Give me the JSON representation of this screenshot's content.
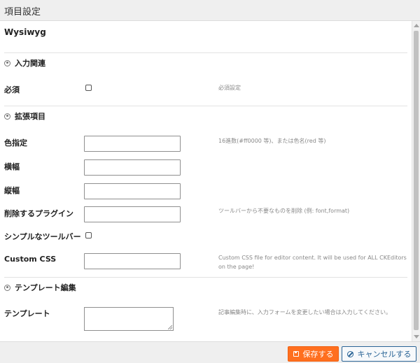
{
  "header": {
    "title": "項目設定"
  },
  "field": {
    "title": "Wysiwyg"
  },
  "sections": {
    "input": {
      "label": "入力関連",
      "icon": "gear-icon"
    },
    "extension": {
      "label": "拡張項目",
      "icon": "gear-icon"
    },
    "template": {
      "label": "テンプレート編集",
      "icon": "gear-icon"
    }
  },
  "rows": {
    "required": {
      "label": "必須",
      "help": "必須設定",
      "checked": false
    },
    "color": {
      "label": "色指定",
      "help": "16進数(#ff0000 等)、または色名(red 等)",
      "value": ""
    },
    "width": {
      "label": "横幅",
      "value": ""
    },
    "height": {
      "label": "縦幅",
      "value": ""
    },
    "remove_plugins": {
      "label": "削除するプラグイン",
      "help": "ツールバーから不要なものを削除 (例: font,format)",
      "value": ""
    },
    "simple_toolbar": {
      "label": "シンプルなツールバー",
      "checked": false
    },
    "custom_css": {
      "label": "Custom CSS",
      "help": "Custom CSS file for editor content. It will be used for ALL CKEditors on the page!",
      "value": ""
    },
    "template": {
      "label": "テンプレート",
      "help": "記事編集時に、入力フォームを変更したい場合は入力してください。",
      "value": ""
    }
  },
  "footer": {
    "save_label": "保存する",
    "cancel_label": "キャンセルする",
    "save_color": "#ff6f1f",
    "cancel_color": "#2a6496"
  }
}
